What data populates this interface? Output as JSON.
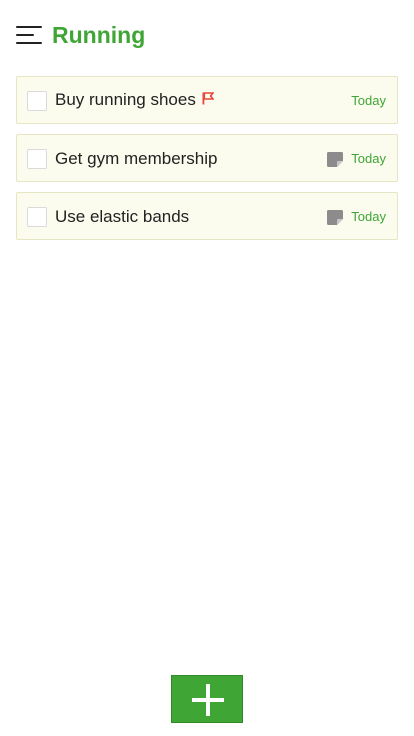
{
  "header": {
    "menu_icon": "hamburger-menu-icon",
    "title": "Running"
  },
  "tasks": [
    {
      "label": "Buy running shoes",
      "due": "Today",
      "flagged": true,
      "has_note": false,
      "flag_color": "#e8453c"
    },
    {
      "label": "Get gym membership",
      "due": "Today",
      "flagged": false,
      "has_note": true
    },
    {
      "label": "Use elastic bands",
      "due": "Today",
      "flagged": false,
      "has_note": true
    }
  ],
  "add_button": {
    "icon": "plus-icon"
  },
  "colors": {
    "accent": "#3fa535",
    "task_bg": "#fbfbee",
    "flag": "#e8453c",
    "note": "#8c8c8c"
  }
}
